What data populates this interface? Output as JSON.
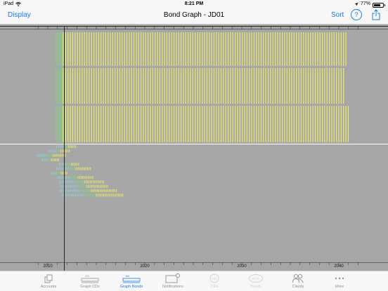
{
  "status_bar": {
    "device": "iPad",
    "time": "8:21 PM",
    "battery_text": "77%",
    "battery_level": 0.77
  },
  "nav": {
    "title": "Bond Graph - JD01",
    "display_label": "Display",
    "sort_label": "Sort",
    "help_label": "?",
    "accent_color": "#1a7af0"
  },
  "graph": {
    "background": "#a6a6a6",
    "colors": {
      "maturity": "#eeee6a",
      "start": "#7fd67f",
      "early": "#8fd0d6",
      "cursor": "#000000",
      "divider": "#ffffff"
    },
    "x_axis": {
      "min_year": 2008.7,
      "max_year": 2043
    },
    "years": [
      "2010",
      "2020",
      "2030",
      "2040"
    ],
    "cursor_year": 2011.7,
    "upper_bands": [
      {
        "start_year": 2011.6,
        "end_year": 2040.8
      },
      {
        "start_year": 2011.6,
        "end_year": 2040.6
      },
      {
        "start_year": 2011.6,
        "end_year": 2041.1
      }
    ],
    "lower_rows": [
      {
        "start_year": 2010.9,
        "end_year": 2013.0
      },
      {
        "start_year": 2010.1,
        "end_year": 2012.3
      },
      {
        "start_year": 2008.9,
        "end_year": 2011.8
      },
      {
        "start_year": 2009.3,
        "end_year": 2011.2
      },
      {
        "start_year": 2011.2,
        "end_year": 2013.2
      },
      {
        "start_year": 2010.9,
        "end_year": 2014.4
      },
      {
        "start_year": 2010.3,
        "end_year": 2012.0
      },
      {
        "start_year": 2011.0,
        "end_year": 2014.8
      },
      {
        "start_year": 2011.2,
        "end_year": 2015.8
      },
      {
        "start_year": 2011.3,
        "end_year": 2016.2
      },
      {
        "start_year": 2011.3,
        "end_year": 2017.1
      },
      {
        "start_year": 2011.5,
        "end_year": 2017.8
      }
    ]
  },
  "tabs": [
    {
      "label": "Accounts",
      "icon": "accounts-icon",
      "state": "normal"
    },
    {
      "label": "Graph CDs",
      "icon": "graph-cds-icon",
      "state": "normal"
    },
    {
      "label": "Graph Bonds",
      "icon": "graph-bonds-icon",
      "state": "active"
    },
    {
      "label": "Notifications",
      "icon": "notifications-icon",
      "state": "normal"
    },
    {
      "label": "CDs",
      "icon": "cds-icon",
      "state": "disabled"
    },
    {
      "label": "Bonds",
      "icon": "bonds-icon",
      "state": "disabled"
    },
    {
      "label": "Clients",
      "icon": "clients-icon",
      "state": "normal"
    },
    {
      "label": "More",
      "icon": "more-icon",
      "state": "normal"
    }
  ]
}
